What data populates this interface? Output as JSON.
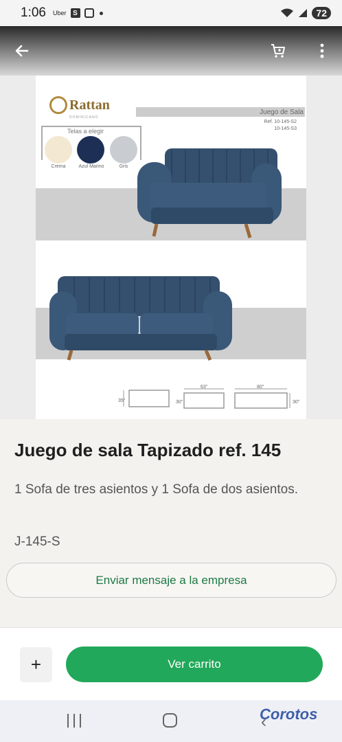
{
  "status_bar": {
    "time": "1:06",
    "app_label": "Uber",
    "s_badge": "S",
    "battery": "72"
  },
  "catalog": {
    "brand_name": "Rattan",
    "brand_sub": "DOMINICANO",
    "collection_title": "Juego de Sala",
    "ref_line1": "Ref. 10-145-S2",
    "ref_line2": "10-145-S3",
    "fabric_title": "Telas a elegir",
    "swatches": [
      {
        "label": "Crema",
        "color": "#f3e8d2"
      },
      {
        "label": "Azul Marino",
        "color": "#1d2f55"
      },
      {
        "label": "Gris",
        "color": "#c9cdd1"
      }
    ],
    "sofa_color": "#34506e",
    "dims": {
      "d1": "35\"",
      "d2": "63\"",
      "d3": "30\"",
      "d4": "80\"",
      "d5": "30\""
    }
  },
  "product": {
    "title": "Juego de sala Tapizado ref. 145",
    "description": "1 Sofa de tres asientos y 1 Sofa de dos asientos.",
    "code": "J-145-S",
    "message_button": "Enviar mensaje a la empresa"
  },
  "actions": {
    "add_label": "+",
    "cart_label": "Ver carrito"
  },
  "watermark": "Corotos",
  "colors": {
    "accent_green": "#22a85a",
    "text_green": "#1c7a44"
  }
}
